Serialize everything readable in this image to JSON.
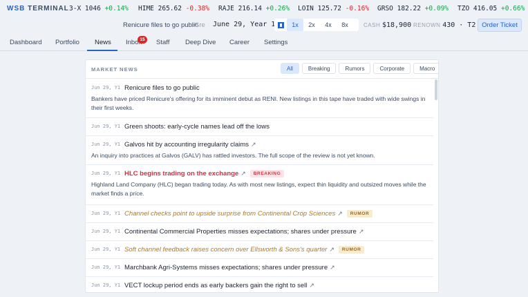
{
  "ticker": {
    "brand_a": "WSB",
    "brand_b": "TERMINAL",
    "items": [
      {
        "sym": "3-X",
        "price": "1046",
        "chg": "+0.14%",
        "dir": "up"
      },
      {
        "sym": "HIME",
        "price": "265.62",
        "chg": "-0.38%",
        "dir": "dn"
      },
      {
        "sym": "RAJE",
        "price": "216.14",
        "chg": "+0.26%",
        "dir": "up"
      },
      {
        "sym": "LOIN",
        "price": "125.72",
        "chg": "-0.16%",
        "dir": "dn"
      },
      {
        "sym": "GRSO",
        "price": "182.22",
        "chg": "+0.09%",
        "dir": "up"
      },
      {
        "sym": "TZO",
        "price": "416.05",
        "chg": "+0.66%",
        "dir": "up"
      }
    ]
  },
  "status": {
    "news_flash": "Renicure files to go public",
    "news_trunc": "Gre",
    "date": "June 29, Year 1",
    "speeds": [
      "1x",
      "2x",
      "4x",
      "8x"
    ],
    "active_speed": "1x",
    "cash_label": "CASH",
    "cash_value": "$18,900",
    "renown_label": "RENOWN",
    "renown_value": "430 · T2",
    "order_button": "Order Ticket"
  },
  "nav": {
    "tabs": [
      "Dashboard",
      "Portfolio",
      "News",
      "Inbox",
      "Staff",
      "Deep Dive",
      "Career",
      "Settings"
    ],
    "active": "News",
    "inbox_badge": "15"
  },
  "news": {
    "title": "MARKET NEWS",
    "filters": [
      "All",
      "Breaking",
      "Rumors",
      "Corporate",
      "Macro"
    ],
    "active_filter": "All",
    "items": [
      {
        "date": "Jun 29, Y1",
        "headline": "Renicure files to go public",
        "kind": "normal",
        "link": false,
        "tag": "",
        "body": "Bankers have priced Renicure's offering for its imminent debut as RENI. New listings in this tape have traded with wide swings in their first weeks."
      },
      {
        "date": "Jun 29, Y1",
        "headline": "Green shoots: early-cycle names lead off the lows",
        "kind": "normal",
        "link": false,
        "tag": "",
        "body": ""
      },
      {
        "date": "Jun 29, Y1",
        "headline": "Galvos hit by accounting irregularity claims",
        "kind": "normal",
        "link": true,
        "tag": "",
        "body": "An inquiry into practices at Galvos (GALV) has rattled investors. The full scope of the review is not yet known."
      },
      {
        "date": "Jun 29, Y1",
        "headline": "HLC begins trading on the exchange",
        "kind": "breaking",
        "link": true,
        "tag": "BREAKING",
        "body": "Highland Land Company (HLC) began trading today. As with most new listings, expect thin liquidity and outsized moves while the market finds a price."
      },
      {
        "date": "Jun 29, Y1",
        "headline": "Channel checks point to upside surprise from Continental Crop Sciences",
        "kind": "rumor",
        "link": true,
        "tag": "RUMOR",
        "body": ""
      },
      {
        "date": "Jun 29, Y1",
        "headline": "Continental Commercial Properties misses expectations; shares under pressure",
        "kind": "normal",
        "link": true,
        "tag": "",
        "body": ""
      },
      {
        "date": "Jun 29, Y1",
        "headline": "Soft channel feedback raises concern over Ellsworth & Sons's quarter",
        "kind": "rumor",
        "link": true,
        "tag": "RUMOR",
        "body": ""
      },
      {
        "date": "Jun 29, Y1",
        "headline": "Marchbank Agri-Systems misses expectations; shares under pressure",
        "kind": "normal",
        "link": true,
        "tag": "",
        "body": ""
      },
      {
        "date": "Jun 29, Y1",
        "headline": "VECT lockup period ends as early backers gain the right to sell",
        "kind": "normal",
        "link": true,
        "tag": "",
        "body": ""
      }
    ],
    "link_icon": "↗"
  },
  "colors": {
    "accent": "#2563c9",
    "up": "#16a34a",
    "down": "#dc2626",
    "breaking": "#d23045",
    "rumor": "#b07a1e"
  }
}
